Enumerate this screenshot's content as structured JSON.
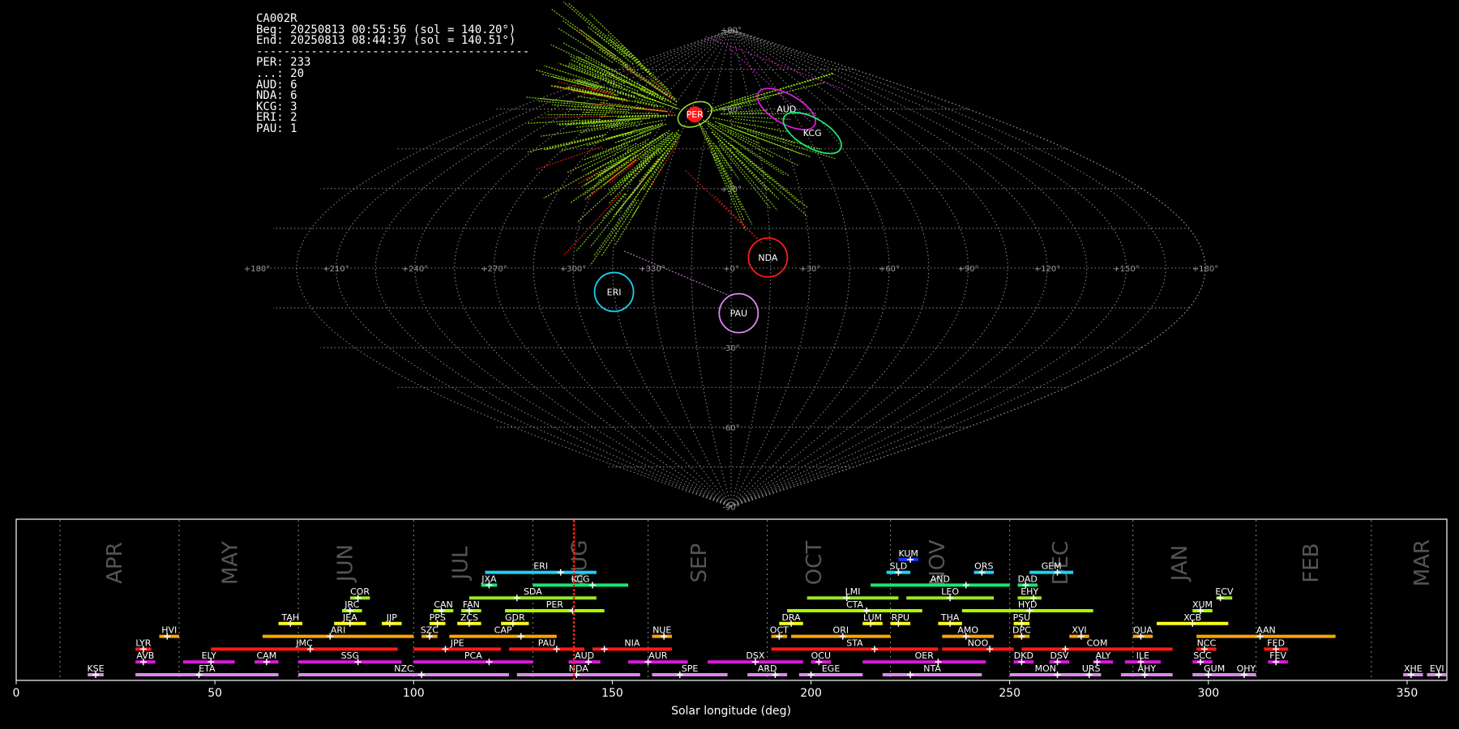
{
  "summary": {
    "camera": "CA002R",
    "begin": "Beg: 20250813 00:55:56 (sol = 140.20°)",
    "end": "End: 20250813 08:44:37 (sol = 140.51°)",
    "separator": "----------------------------------------",
    "counts": [
      "PER: 233",
      "...: 20",
      "AUD: 6",
      "NDA: 6",
      "KCG: 3",
      "ERI: 2",
      "PAU: 1"
    ]
  },
  "colors": {
    "red": "#ff1a1a",
    "orange": "#ffa500",
    "yellow": "#ffff1a",
    "yellowgreen": "#9ae62e",
    "green": "#1ae673",
    "cyan": "#19d3f3",
    "blue": "#1a33ff",
    "magenta": "#d91ad9",
    "violet": "#dd88ee",
    "lime": "#aaff00",
    "grid": "#9a9a9a",
    "month": "#555555"
  },
  "sky_map": {
    "projection": "sinusoidal",
    "lon_labels": [
      "+180°",
      "+150°",
      "+120°",
      "+90°",
      "+60°",
      "+30°",
      "+0°",
      "+330°",
      "+300°",
      "+270°",
      "+240°",
      "+210°",
      "+180°"
    ],
    "lat_labels": [
      "+90°",
      "+60°",
      "+30°",
      "-30°",
      "-60°",
      "-90°"
    ],
    "radiants": [
      {
        "name": "PER",
        "lon": 26,
        "lat": 58,
        "color": "red",
        "size": "large"
      },
      {
        "name": "AUD",
        "lon": 318,
        "lat": 60,
        "color": "magenta",
        "size": "small"
      },
      {
        "name": "KCG",
        "lon": 311,
        "lat": 51,
        "color": "green",
        "size": "small"
      },
      {
        "name": "NDA",
        "lon": 346,
        "lat": 4,
        "color": "red",
        "size": "small"
      },
      {
        "name": "ERI",
        "lon": 45,
        "lat": -9,
        "color": "cyan",
        "size": "small"
      },
      {
        "name": "PAU",
        "lon": 357,
        "lat": -17,
        "color": "violet",
        "size": "small"
      }
    ]
  },
  "chart_data": {
    "type": "gantt",
    "xlabel": "Solar longitude (deg)",
    "xlim": [
      0,
      360
    ],
    "x_ticks": [
      0,
      50,
      100,
      150,
      200,
      250,
      300,
      350
    ],
    "current_sol": 140.35,
    "month_boundaries": [
      11,
      41,
      71,
      100,
      130,
      159,
      189,
      220,
      250,
      281,
      312,
      341
    ],
    "months": [
      {
        "name": "APR",
        "at": 25
      },
      {
        "name": "MAY",
        "at": 54
      },
      {
        "name": "JUN",
        "at": 83
      },
      {
        "name": "JUL",
        "at": 112
      },
      {
        "name": "AUG",
        "at": 142
      },
      {
        "name": "SEP",
        "at": 172
      },
      {
        "name": "OCT",
        "at": 201
      },
      {
        "name": "NOV",
        "at": 232
      },
      {
        "name": "DEC",
        "at": 263
      },
      {
        "name": "JAN",
        "at": 293
      },
      {
        "name": "FEB",
        "at": 326
      },
      {
        "name": "MAR",
        "at": 354
      }
    ],
    "showers": [
      {
        "name": "KUM",
        "start": 222,
        "end": 227,
        "peak": 225,
        "row": 10,
        "color": "blue"
      },
      {
        "name": "ERI",
        "start": 118,
        "end": 146,
        "peak": 137,
        "row": 9,
        "color": "cyan"
      },
      {
        "name": "SLD",
        "start": 219,
        "end": 225,
        "peak": 222,
        "row": 9,
        "color": "cyan"
      },
      {
        "name": "ORS",
        "start": 241,
        "end": 246,
        "peak": 243,
        "row": 9,
        "color": "cyan"
      },
      {
        "name": "GEM",
        "start": 255,
        "end": 266,
        "peak": 262,
        "row": 9,
        "color": "cyan"
      },
      {
        "name": "JXA",
        "start": 117,
        "end": 121,
        "peak": 119,
        "row": 8,
        "color": "green"
      },
      {
        "name": "KCG",
        "start": 130,
        "end": 154,
        "peak": 145,
        "row": 8,
        "color": "green"
      },
      {
        "name": "AND",
        "start": 215,
        "end": 250,
        "peak": 239,
        "row": 8,
        "color": "green"
      },
      {
        "name": "DAD",
        "start": 252,
        "end": 257,
        "peak": 254,
        "row": 8,
        "color": "green"
      },
      {
        "name": "COR",
        "start": 84,
        "end": 89,
        "peak": 86,
        "row": 7,
        "color": "yellowgreen"
      },
      {
        "name": "SDA",
        "start": 114,
        "end": 146,
        "peak": 126,
        "row": 7,
        "color": "yellowgreen"
      },
      {
        "name": "LMI",
        "start": 199,
        "end": 222,
        "peak": 209,
        "row": 7,
        "color": "yellowgreen"
      },
      {
        "name": "LEO",
        "start": 224,
        "end": 246,
        "peak": 235,
        "row": 7,
        "color": "yellowgreen"
      },
      {
        "name": "EHY",
        "start": 252,
        "end": 258,
        "peak": 256,
        "row": 7,
        "color": "yellowgreen"
      },
      {
        "name": "ECV",
        "start": 302,
        "end": 306,
        "peak": 303,
        "row": 7,
        "color": "yellowgreen"
      },
      {
        "name": "JRC",
        "start": 82,
        "end": 87,
        "peak": 84,
        "row": 6,
        "color": "lime"
      },
      {
        "name": "CAN",
        "start": 105,
        "end": 110,
        "peak": 107,
        "row": 6,
        "color": "lime"
      },
      {
        "name": "FAN",
        "start": 112,
        "end": 117,
        "peak": 114,
        "row": 6,
        "color": "lime"
      },
      {
        "name": "PER",
        "start": 123,
        "end": 148,
        "peak": 140,
        "row": 6,
        "color": "lime"
      },
      {
        "name": "CTA",
        "start": 194,
        "end": 228,
        "peak": 214,
        "row": 6,
        "color": "lime"
      },
      {
        "name": "HYD",
        "start": 238,
        "end": 271,
        "peak": 255,
        "row": 6,
        "color": "lime"
      },
      {
        "name": "XUM",
        "start": 296,
        "end": 301,
        "peak": 298,
        "row": 6,
        "color": "lime"
      },
      {
        "name": "TAH",
        "start": 66,
        "end": 72,
        "peak": 69,
        "row": 5,
        "color": "yellow"
      },
      {
        "name": "JEA",
        "start": 80,
        "end": 88,
        "peak": 84,
        "row": 5,
        "color": "yellow"
      },
      {
        "name": "JIP",
        "start": 92,
        "end": 97,
        "peak": 94,
        "row": 5,
        "color": "yellow"
      },
      {
        "name": "PPS",
        "start": 104,
        "end": 108,
        "peak": 106,
        "row": 5,
        "color": "yellow"
      },
      {
        "name": "ZCS",
        "start": 111,
        "end": 117,
        "peak": 114,
        "row": 5,
        "color": "yellow"
      },
      {
        "name": "GDR",
        "start": 122,
        "end": 129,
        "peak": 125,
        "row": 5,
        "color": "yellow"
      },
      {
        "name": "DRA",
        "start": 192,
        "end": 198,
        "peak": 195,
        "row": 5,
        "color": "yellow"
      },
      {
        "name": "LUM",
        "start": 213,
        "end": 218,
        "peak": 215,
        "row": 5,
        "color": "yellow"
      },
      {
        "name": "RPU",
        "start": 220,
        "end": 225,
        "peak": 222,
        "row": 5,
        "color": "yellow"
      },
      {
        "name": "THA",
        "start": 232,
        "end": 238,
        "peak": 235,
        "row": 5,
        "color": "yellow"
      },
      {
        "name": "PSU",
        "start": 251,
        "end": 255,
        "peak": 253,
        "row": 5,
        "color": "yellow"
      },
      {
        "name": "XCB",
        "start": 287,
        "end": 305,
        "peak": 296,
        "row": 5,
        "color": "yellow"
      },
      {
        "name": "HVI",
        "start": 36,
        "end": 41,
        "peak": 38,
        "row": 4,
        "color": "orange"
      },
      {
        "name": "ARI",
        "start": 62,
        "end": 100,
        "peak": 79,
        "row": 4,
        "color": "orange"
      },
      {
        "name": "SZC",
        "start": 102,
        "end": 106,
        "peak": 104,
        "row": 4,
        "color": "orange"
      },
      {
        "name": "CAP",
        "start": 109,
        "end": 136,
        "peak": 127,
        "row": 4,
        "color": "orange"
      },
      {
        "name": "NUE",
        "start": 160,
        "end": 165,
        "peak": 163,
        "row": 4,
        "color": "orange"
      },
      {
        "name": "OCT",
        "start": 190,
        "end": 194,
        "peak": 192,
        "row": 4,
        "color": "orange"
      },
      {
        "name": "ORI",
        "start": 195,
        "end": 220,
        "peak": 208,
        "row": 4,
        "color": "orange"
      },
      {
        "name": "AMO",
        "start": 233,
        "end": 246,
        "peak": 239,
        "row": 4,
        "color": "orange"
      },
      {
        "name": "DPC",
        "start": 251,
        "end": 255,
        "peak": 253,
        "row": 4,
        "color": "orange"
      },
      {
        "name": "XVI",
        "start": 265,
        "end": 270,
        "peak": 268,
        "row": 4,
        "color": "orange"
      },
      {
        "name": "QUA",
        "start": 281,
        "end": 286,
        "peak": 283,
        "row": 4,
        "color": "orange"
      },
      {
        "name": "AAN",
        "start": 297,
        "end": 332,
        "peak": 313,
        "row": 4,
        "color": "orange"
      },
      {
        "name": "LYR",
        "start": 30,
        "end": 34,
        "peak": 32,
        "row": 3,
        "color": "red"
      },
      {
        "name": "JMC",
        "start": 49,
        "end": 96,
        "peak": 74,
        "row": 3,
        "color": "red"
      },
      {
        "name": "JPE",
        "start": 100,
        "end": 122,
        "peak": 108,
        "row": 3,
        "color": "red"
      },
      {
        "name": "PAU",
        "start": 124,
        "end": 143,
        "peak": 136,
        "row": 3,
        "color": "red"
      },
      {
        "name": "NIA",
        "start": 145,
        "end": 165,
        "peak": 148,
        "row": 3,
        "color": "red"
      },
      {
        "name": "STA",
        "start": 190,
        "end": 232,
        "peak": 216,
        "row": 3,
        "color": "red"
      },
      {
        "name": "NOO",
        "start": 233,
        "end": 251,
        "peak": 245,
        "row": 3,
        "color": "red"
      },
      {
        "name": "COM",
        "start": 253,
        "end": 291,
        "peak": 264,
        "row": 3,
        "color": "red"
      },
      {
        "name": "NCC",
        "start": 297,
        "end": 302,
        "peak": 299,
        "row": 3,
        "color": "red"
      },
      {
        "name": "FED",
        "start": 314,
        "end": 320,
        "peak": 317,
        "row": 3,
        "color": "red"
      },
      {
        "name": "AVB",
        "start": 30,
        "end": 35,
        "peak": 32,
        "row": 2,
        "color": "magenta"
      },
      {
        "name": "ELY",
        "start": 42,
        "end": 55,
        "peak": 49,
        "row": 2,
        "color": "magenta"
      },
      {
        "name": "CAM",
        "start": 60,
        "end": 66,
        "peak": 63,
        "row": 2,
        "color": "magenta"
      },
      {
        "name": "SSG",
        "start": 71,
        "end": 97,
        "peak": 86,
        "row": 2,
        "color": "magenta"
      },
      {
        "name": "PCA",
        "start": 100,
        "end": 130,
        "peak": 119,
        "row": 2,
        "color": "magenta"
      },
      {
        "name": "AUD",
        "start": 139,
        "end": 147,
        "peak": 144,
        "row": 2,
        "color": "magenta"
      },
      {
        "name": "AUR",
        "start": 154,
        "end": 169,
        "peak": 159,
        "row": 2,
        "color": "magenta"
      },
      {
        "name": "DSX",
        "start": 174,
        "end": 198,
        "peak": 186,
        "row": 2,
        "color": "magenta"
      },
      {
        "name": "OCU",
        "start": 200,
        "end": 205,
        "peak": 202,
        "row": 2,
        "color": "magenta"
      },
      {
        "name": "OER",
        "start": 213,
        "end": 244,
        "peak": 232,
        "row": 2,
        "color": "magenta"
      },
      {
        "name": "DKD",
        "start": 251,
        "end": 256,
        "peak": 253,
        "row": 2,
        "color": "magenta"
      },
      {
        "name": "DSV",
        "start": 260,
        "end": 265,
        "peak": 262,
        "row": 2,
        "color": "magenta"
      },
      {
        "name": "ALY",
        "start": 271,
        "end": 276,
        "peak": 272,
        "row": 2,
        "color": "magenta"
      },
      {
        "name": "ILE",
        "start": 279,
        "end": 288,
        "peak": 283,
        "row": 2,
        "color": "magenta"
      },
      {
        "name": "SCC",
        "start": 296,
        "end": 301,
        "peak": 298,
        "row": 2,
        "color": "magenta"
      },
      {
        "name": "FEV",
        "start": 315,
        "end": 320,
        "peak": 317,
        "row": 2,
        "color": "magenta"
      },
      {
        "name": "KSE",
        "start": 18,
        "end": 22,
        "peak": 20,
        "row": 1,
        "color": "violet"
      },
      {
        "name": "ETA",
        "start": 30,
        "end": 66,
        "peak": 46,
        "row": 1,
        "color": "violet"
      },
      {
        "name": "NZC",
        "start": 71,
        "end": 124,
        "peak": 102,
        "row": 1,
        "color": "violet"
      },
      {
        "name": "NDA",
        "start": 126,
        "end": 157,
        "peak": 141,
        "row": 1,
        "color": "violet"
      },
      {
        "name": "SPE",
        "start": 160,
        "end": 179,
        "peak": 167,
        "row": 1,
        "color": "violet"
      },
      {
        "name": "ARD",
        "start": 184,
        "end": 194,
        "peak": 191,
        "row": 1,
        "color": "violet"
      },
      {
        "name": "EGE",
        "start": 197,
        "end": 213,
        "peak": 200,
        "row": 1,
        "color": "violet"
      },
      {
        "name": "NTA",
        "start": 218,
        "end": 243,
        "peak": 225,
        "row": 1,
        "color": "violet"
      },
      {
        "name": "MON",
        "start": 250,
        "end": 268,
        "peak": 262,
        "row": 1,
        "color": "violet"
      },
      {
        "name": "URS",
        "start": 268,
        "end": 273,
        "peak": 270,
        "row": 1,
        "color": "violet"
      },
      {
        "name": "AHY",
        "start": 278,
        "end": 291,
        "peak": 284,
        "row": 1,
        "color": "violet"
      },
      {
        "name": "GUM",
        "start": 296,
        "end": 307,
        "peak": 300,
        "row": 1,
        "color": "violet"
      },
      {
        "name": "OHY",
        "start": 307,
        "end": 312,
        "peak": 309,
        "row": 1,
        "color": "violet"
      },
      {
        "name": "XHE",
        "start": 349,
        "end": 354,
        "peak": 351,
        "row": 1,
        "color": "violet"
      },
      {
        "name": "EVI",
        "start": 355,
        "end": 360,
        "peak": 358,
        "row": 1,
        "color": "violet"
      }
    ]
  }
}
